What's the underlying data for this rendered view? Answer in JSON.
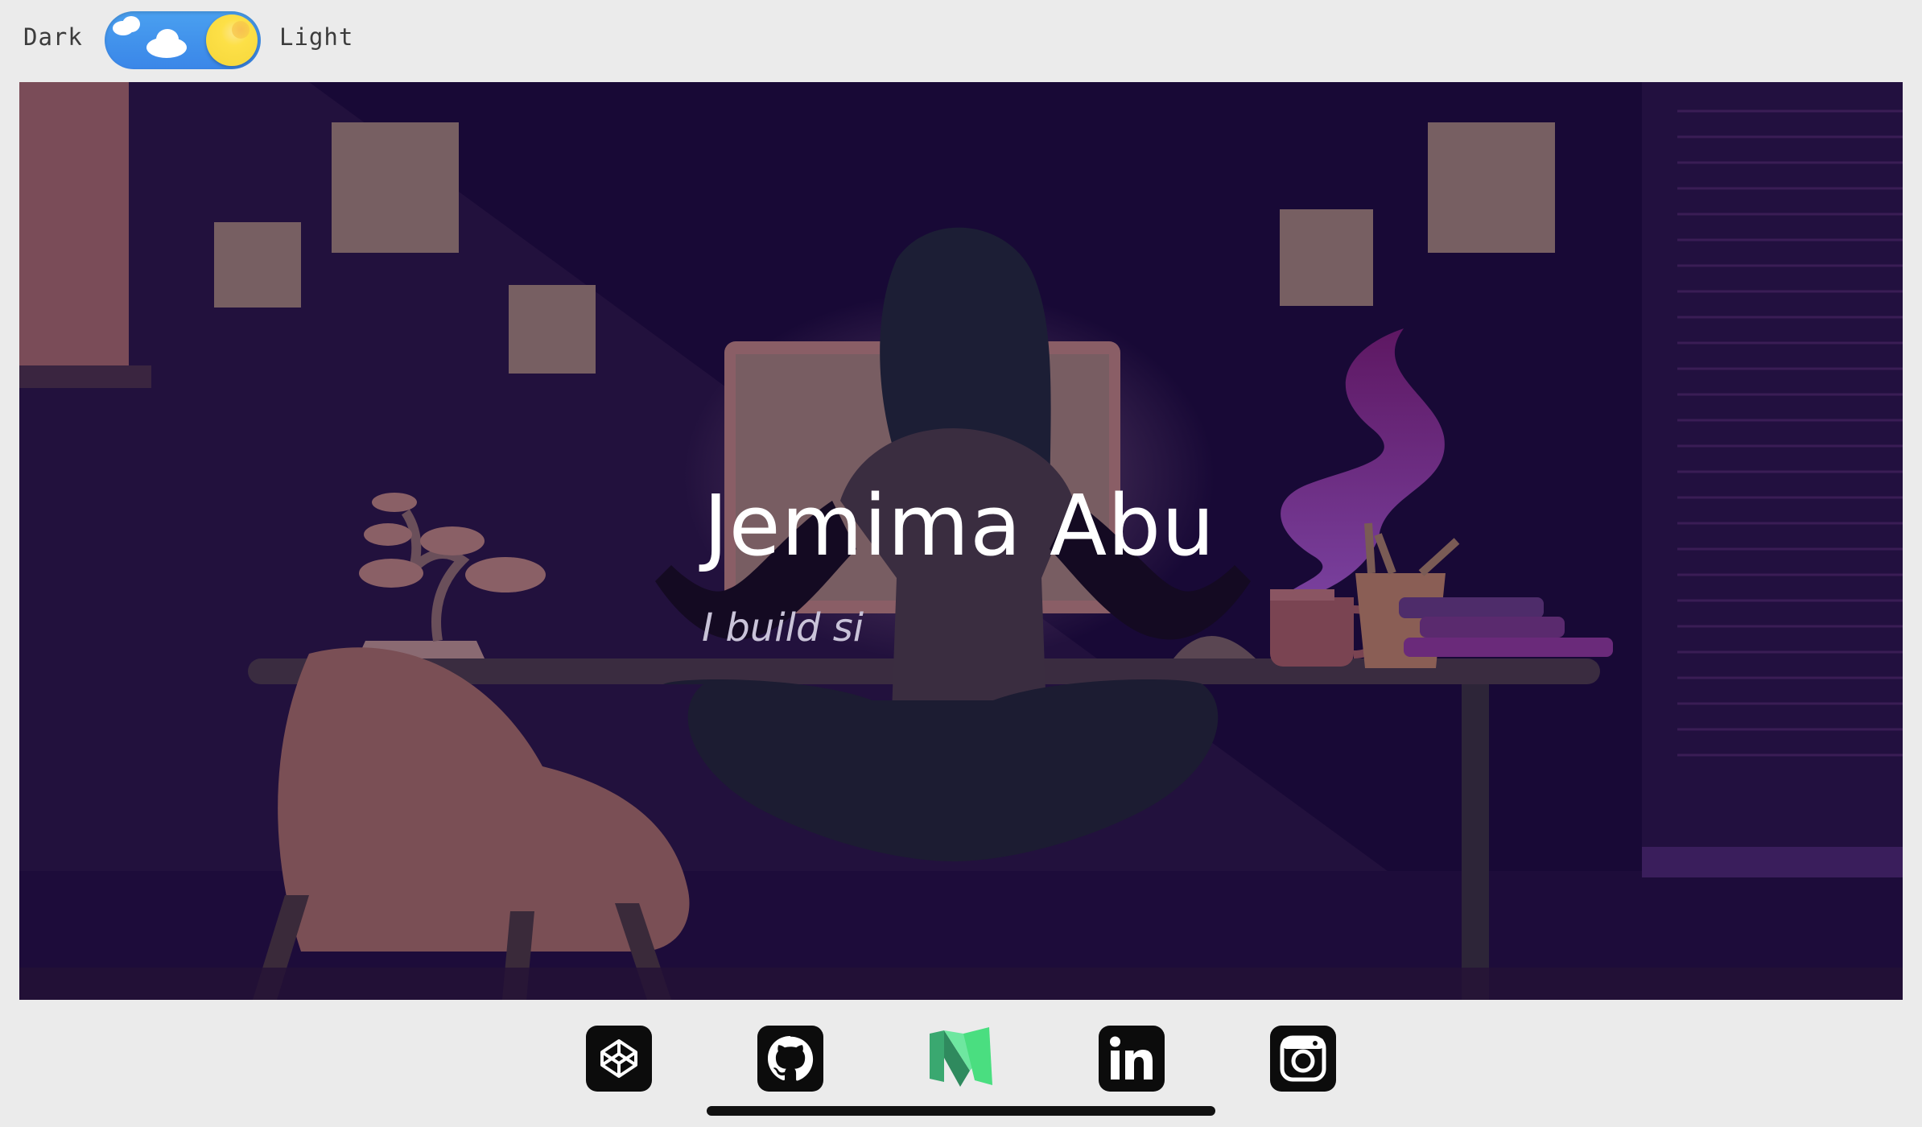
{
  "theme_toggle": {
    "dark_label": "Dark",
    "light_label": "Light",
    "state": "light",
    "track_color": "#3a86e8",
    "knob_color": "#fde047"
  },
  "hero": {
    "name": "Jemima Abu",
    "tagline": "I build si"
  },
  "social_links": [
    {
      "name": "codepen",
      "icon": "codepen-icon"
    },
    {
      "name": "github",
      "icon": "github-icon"
    },
    {
      "name": "medium",
      "icon": "medium-icon"
    },
    {
      "name": "linkedin",
      "icon": "linkedin-icon",
      "text": "in"
    },
    {
      "name": "instagram",
      "icon": "instagram-icon"
    }
  ],
  "colors": {
    "page_background": "#ebebeb",
    "hero_background": "#1e0f3b",
    "medium_green": "#4ade80"
  }
}
